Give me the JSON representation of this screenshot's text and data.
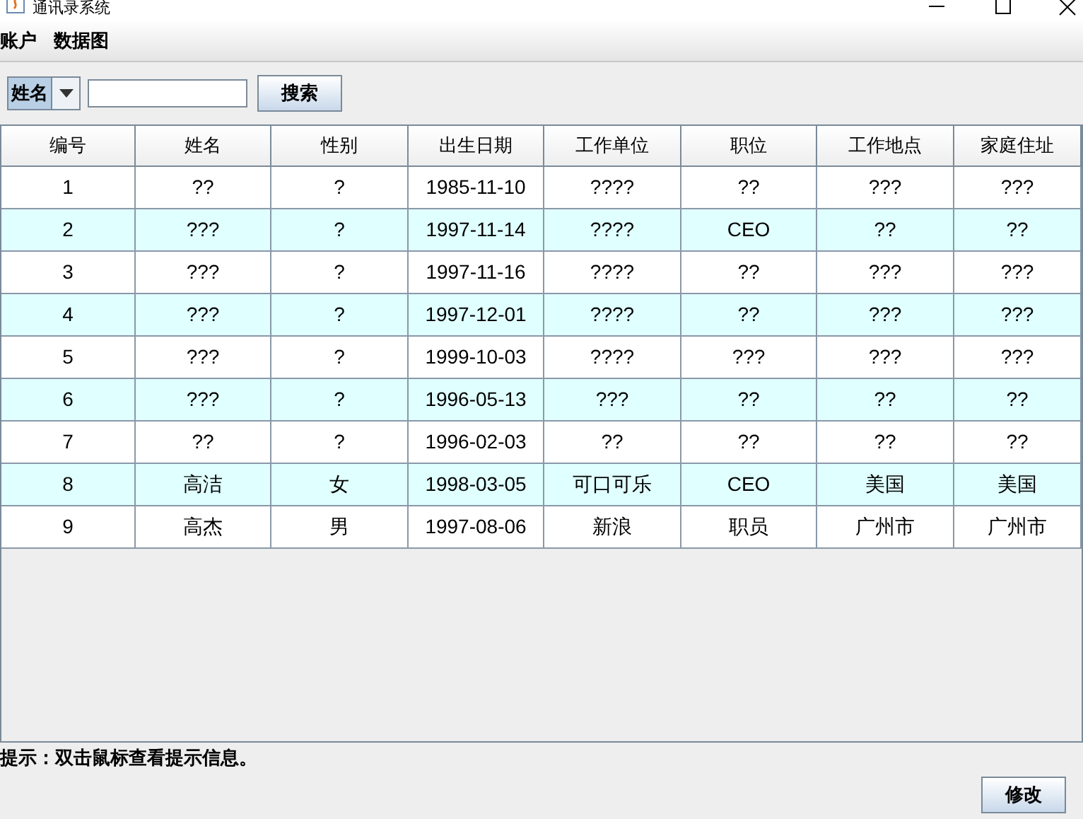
{
  "window": {
    "title": "通讯录系统"
  },
  "menu": [
    "账户",
    "数据图"
  ],
  "search": {
    "field": "姓名",
    "button": "搜索"
  },
  "table": {
    "columns": [
      "编号",
      "姓名",
      "性别",
      "出生日期",
      "工作单位",
      "职位",
      "工作地点",
      "家庭住址"
    ],
    "rows": [
      [
        "1",
        "??",
        "?",
        "1985-11-10",
        "????",
        "??",
        "???",
        "???"
      ],
      [
        "2",
        "???",
        "?",
        "1997-11-14",
        "????",
        "CEO",
        "??",
        "??"
      ],
      [
        "3",
        "???",
        "?",
        "1997-11-16",
        "????",
        "??",
        "???",
        "???"
      ],
      [
        "4",
        "???",
        "?",
        "1997-12-01",
        "????",
        "??",
        "???",
        "???"
      ],
      [
        "5",
        "???",
        "?",
        "1999-10-03",
        "????",
        "???",
        "???",
        "???"
      ],
      [
        "6",
        "???",
        "?",
        "1996-05-13",
        "???",
        "??",
        "??",
        "??"
      ],
      [
        "7",
        "??",
        "?",
        "1996-02-03",
        "??",
        "??",
        "??",
        "??"
      ],
      [
        "8",
        "高洁",
        "女",
        "1998-03-05",
        "可口可乐",
        "CEO",
        "美国",
        "美国"
      ],
      [
        "9",
        "高杰",
        "男",
        "1997-08-06",
        "新浪",
        "职员",
        "广州市",
        "广州市"
      ]
    ]
  },
  "hint": "提示：双击鼠标查看提示信息。",
  "buttons": [
    "修改"
  ]
}
